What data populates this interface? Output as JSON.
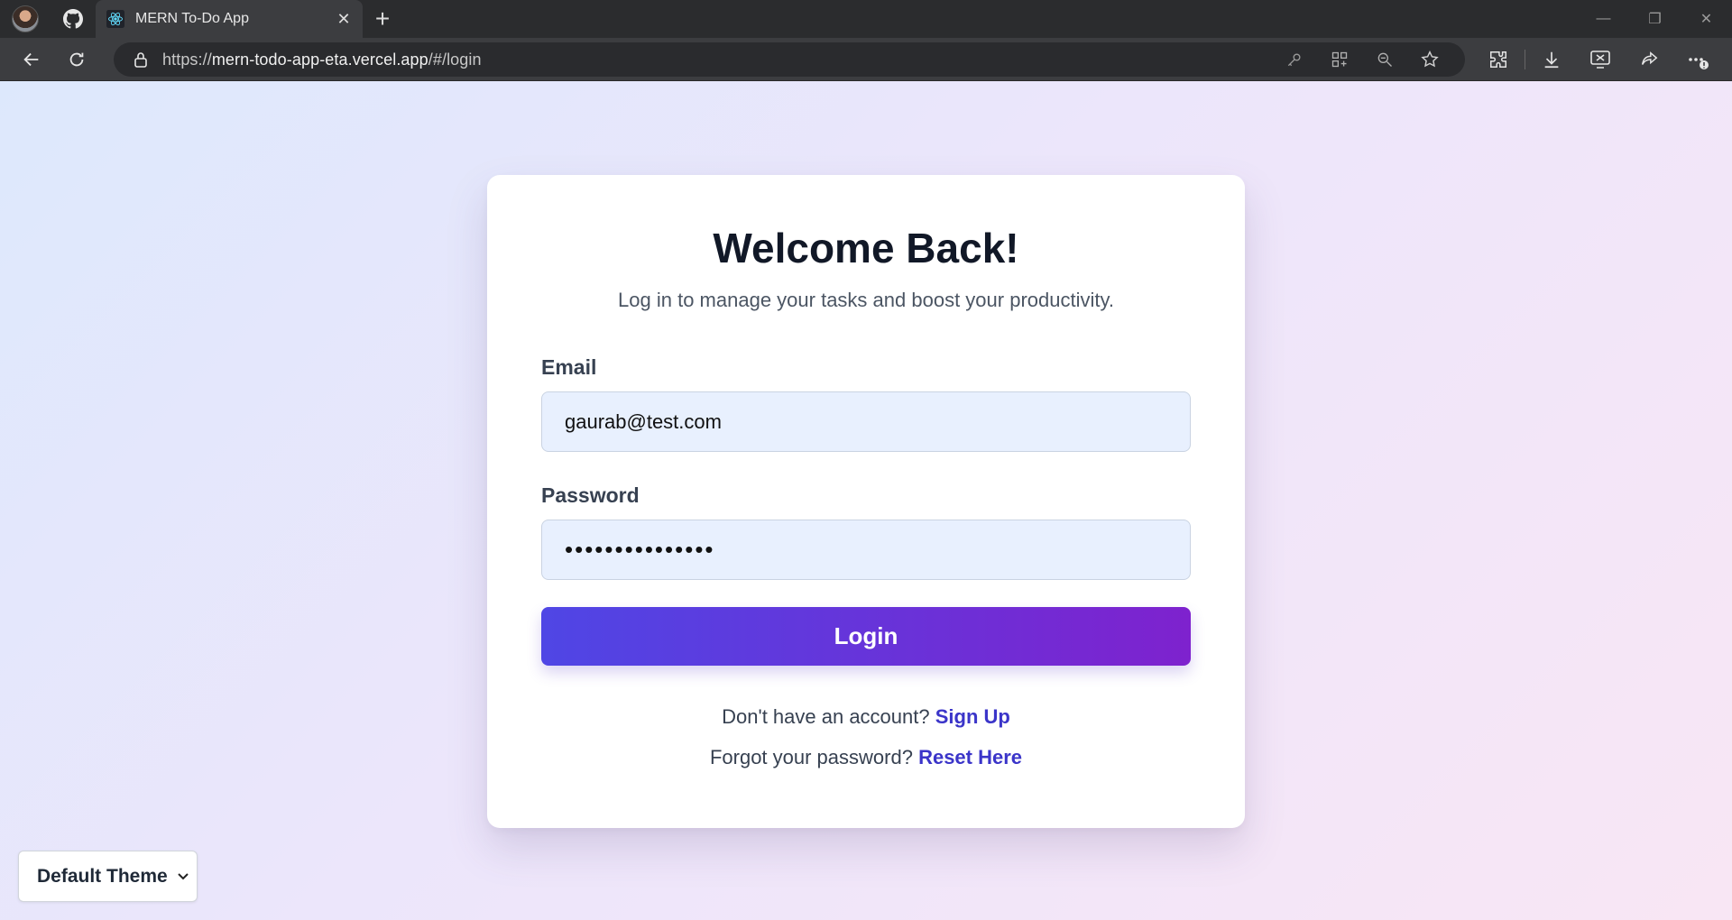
{
  "browser": {
    "tab_title": "MERN To-Do App",
    "new_tab_symbol": "+",
    "url_scheme": "https://",
    "url_host": "mern-todo-app-eta.vercel.app",
    "url_path": "/#/login",
    "icons": [
      "profile-avatar",
      "github-icon",
      "react-icon",
      "close-icon",
      "plus-icon",
      "minimize-icon",
      "restore-icon",
      "window-close-icon",
      "back-icon",
      "reload-icon",
      "lock-icon",
      "key-icon",
      "apps-icon",
      "zoom-out-icon",
      "star-icon",
      "extensions-icon",
      "download-icon",
      "screenshot-icon",
      "share-icon",
      "more-icon"
    ]
  },
  "login": {
    "title": "Welcome Back!",
    "subtitle": "Log in to manage your tasks and boost your productivity.",
    "email_label": "Email",
    "email_value": "gaurab@test.com",
    "password_label": "Password",
    "password_value": "•••••••••••••••",
    "login_button": "Login",
    "signup_prompt": "Don't have an account?",
    "signup_link": "Sign Up",
    "forgot_prompt": "Forgot your password?",
    "reset_link": "Reset Here"
  },
  "theme": {
    "selected": "Default Theme"
  },
  "colors": {
    "accent_start": "#4f46e5",
    "accent_end": "#7e22ce",
    "link": "#3b35c9",
    "title": "#111827"
  }
}
